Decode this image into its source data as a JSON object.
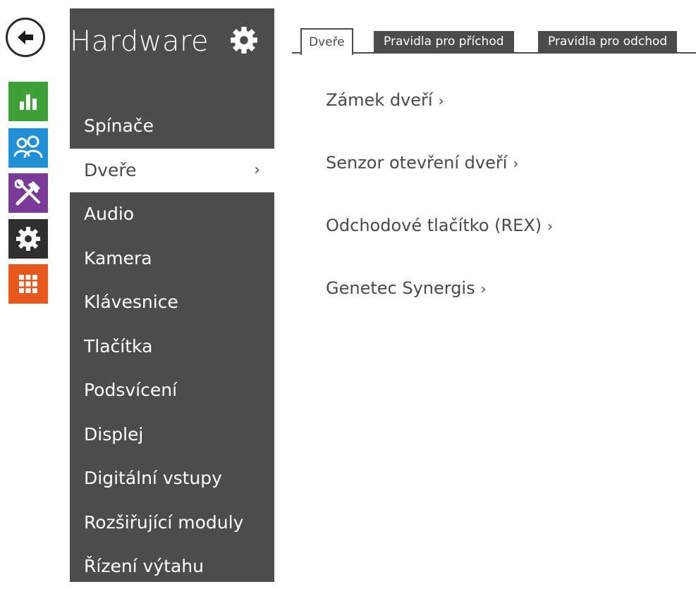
{
  "rail": {
    "icons": [
      {
        "name": "back-arrow-icon",
        "color": "#2b2b2b"
      },
      {
        "name": "bar-chart-icon",
        "color": "#3ea135"
      },
      {
        "name": "users-icon",
        "color": "#1f8fd6"
      },
      {
        "name": "tools-icon",
        "color": "#7a3a97"
      },
      {
        "name": "settings-gear-icon",
        "color": "#2f2f2f"
      },
      {
        "name": "apps-grid-icon",
        "color": "#e8571b"
      }
    ]
  },
  "sidebar": {
    "title": "Hardware",
    "title_icon": "gear-icon",
    "items": [
      {
        "label": "Spínače"
      },
      {
        "label": "Dveře",
        "chevron": "›",
        "active": true
      },
      {
        "label": "Audio"
      },
      {
        "label": "Kamera"
      },
      {
        "label": "Klávesnice"
      },
      {
        "label": "Tlačítka"
      },
      {
        "label": "Podsvícení"
      },
      {
        "label": "Displej"
      },
      {
        "label": "Digitální vstupy"
      },
      {
        "label": "Rozšiřující moduly"
      },
      {
        "label": "Řízení výtahu"
      }
    ]
  },
  "tabs": [
    {
      "label": "Dveře",
      "active": true
    },
    {
      "label": "Pravidla pro příchod"
    },
    {
      "label": "Pravidla pro odchod"
    }
  ],
  "links": [
    {
      "label": "Zámek dveří",
      "arrow": "›"
    },
    {
      "label": "Senzor otevření dveří",
      "arrow": "›"
    },
    {
      "label": "Odchodové tlačítko (REX)",
      "arrow": "›"
    },
    {
      "label": "Genetec Synergis",
      "arrow": "›"
    }
  ],
  "colors": {
    "sidebar_bg": "#4c4c4c",
    "text": "#4a4a4a",
    "active_bg": "#ffffff"
  }
}
